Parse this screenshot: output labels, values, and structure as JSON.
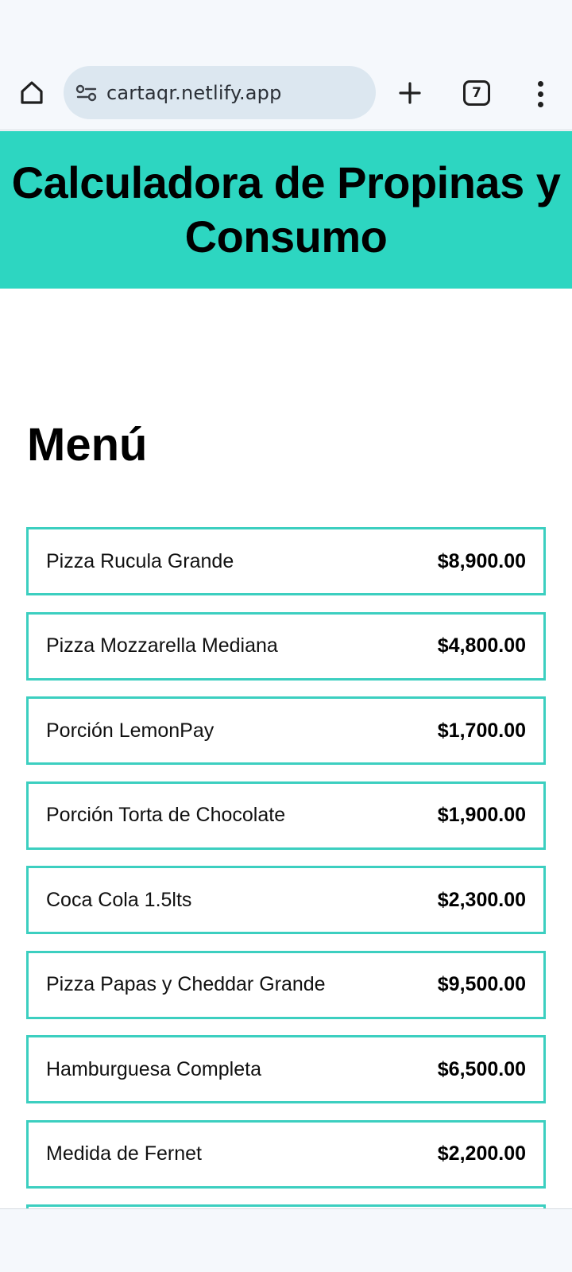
{
  "browser": {
    "url": "cartaqr.netlify.app",
    "tab_count": "7",
    "icons": {
      "home": "home-icon",
      "site_info": "site-info-icon",
      "new_tab": "plus-icon",
      "tabs": "tab-switcher-icon",
      "menu": "more-vert-icon"
    }
  },
  "page": {
    "title": "Calculadora de Propinas y Consumo",
    "menu_heading": "Menú",
    "accent_color": "#2dd6c1",
    "items": [
      {
        "name": "Pizza Rucula Grande",
        "price": "$8,900.00"
      },
      {
        "name": "Pizza Mozzarella Mediana",
        "price": "$4,800.00"
      },
      {
        "name": "Porción LemonPay",
        "price": "$1,700.00"
      },
      {
        "name": "Porción Torta de Chocolate",
        "price": "$1,900.00"
      },
      {
        "name": "Coca Cola 1.5lts",
        "price": "$2,300.00"
      },
      {
        "name": "Pizza Papas y Cheddar Grande",
        "price": "$9,500.00"
      },
      {
        "name": "Hamburguesa Completa",
        "price": "$6,500.00"
      },
      {
        "name": "Medida de Fernet",
        "price": "$2,200.00"
      }
    ]
  }
}
